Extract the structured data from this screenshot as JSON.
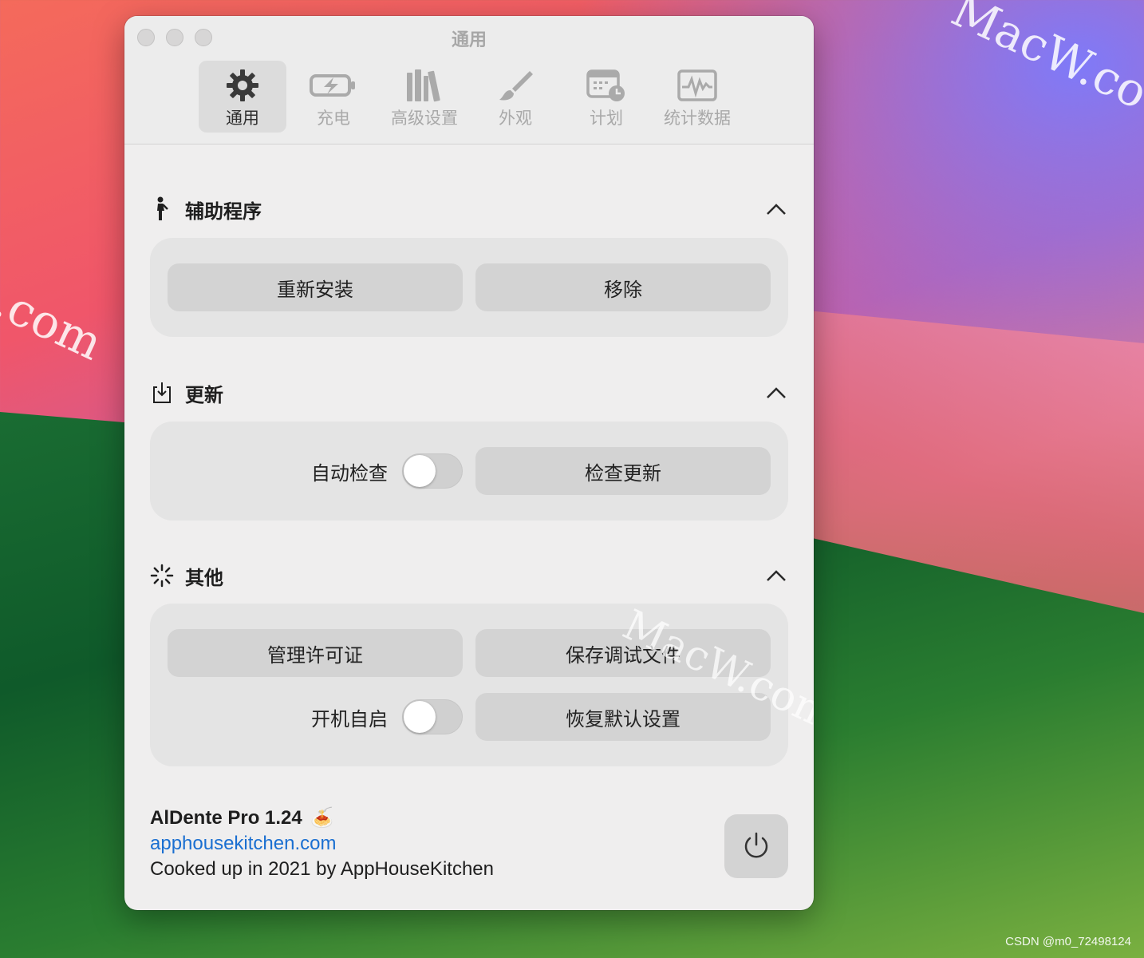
{
  "window": {
    "title": "通用"
  },
  "toolbar": {
    "items": [
      {
        "label": "通用",
        "icon": "gear-icon",
        "active": true
      },
      {
        "label": "充电",
        "icon": "battery-charging-icon",
        "active": false
      },
      {
        "label": "高级设置",
        "icon": "books-icon",
        "active": false
      },
      {
        "label": "外观",
        "icon": "paintbrush-icon",
        "active": false
      },
      {
        "label": "计划",
        "icon": "calendar-clock-icon",
        "active": false
      },
      {
        "label": "统计数据",
        "icon": "waveform-icon",
        "active": false
      }
    ]
  },
  "sections": {
    "helper": {
      "title": "辅助程序",
      "icon": "figure-walk-icon",
      "reinstall": "重新安装",
      "remove": "移除"
    },
    "update": {
      "title": "更新",
      "icon": "download-tray-icon",
      "auto_check": "自动检查",
      "check_now": "检查更新"
    },
    "other": {
      "title": "其他",
      "icon": "spinner-icon",
      "manage_license": "管理许可证",
      "save_debug": "保存调试文件",
      "launch_at_login": "开机自启",
      "restore_defaults": "恢复默认设置"
    }
  },
  "footer": {
    "app_name": "AlDente Pro 1.24",
    "app_emoji": "🍝",
    "link": "apphousekitchen.com",
    "credit": "Cooked up in 2021 by AppHouseKitchen"
  },
  "watermark": {
    "text1": "MacW.co",
    "text2": ".com",
    "text3": "MacW.com"
  },
  "page_credit": "CSDN @m0_72498124",
  "colors": {
    "link": "#1a6fd1",
    "panel": "#e4e4e4",
    "button": "#d3d3d3"
  }
}
